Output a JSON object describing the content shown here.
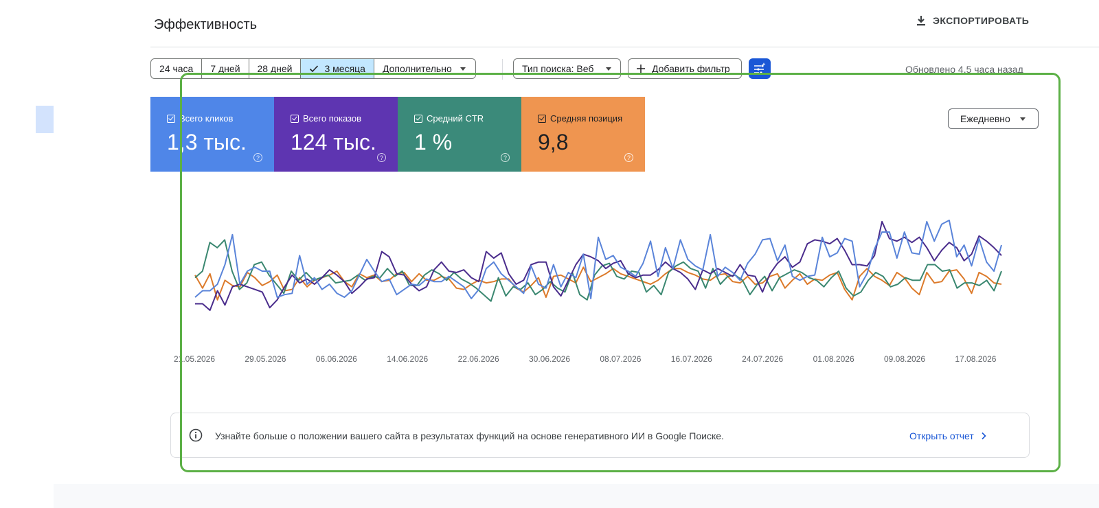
{
  "header": {
    "title": "Эффективность",
    "export_label": "ЭКСПОРТИРОВАТЬ"
  },
  "date_range": {
    "options": [
      "24 часа",
      "7 дней",
      "28 дней",
      "3 месяца",
      "Дополнительно"
    ],
    "selected": "3 месяца"
  },
  "filters": {
    "search_type": "Тип поиска: Веб",
    "add_filter": "Добавить фильтр",
    "updated": "Обновлено 4,5 часа назад"
  },
  "metrics": [
    {
      "label": "Всего кликов",
      "value": "1,3 тыс.",
      "color": "#4f86e8",
      "checked": true
    },
    {
      "label": "Всего показов",
      "value": "124 тыс.",
      "color": "#5e35b1",
      "checked": true
    },
    {
      "label": "Средний CTR",
      "value": "1 %",
      "color": "#3b8a7a",
      "checked": true
    },
    {
      "label": "Средняя позиция",
      "value": "9,8",
      "color": "#ef9550",
      "checked": true
    }
  ],
  "granularity": "Ежедневно",
  "chart_data": {
    "type": "line",
    "x_ticks": [
      "21.05.2026",
      "29.05.2026",
      "06.06.2026",
      "14.06.2026",
      "22.06.2026",
      "30.06.2026",
      "08.07.2026",
      "16.07.2026",
      "24.07.2026",
      "01.08.2026",
      "09.08.2026",
      "17.08.2026"
    ],
    "series": [
      {
        "name": "Всего кликов",
        "color": "#5a84d9",
        "values": [
          30,
          35,
          35,
          40,
          55,
          78,
          40,
          50,
          53,
          50,
          50,
          30,
          32,
          33,
          62,
          40,
          45,
          36,
          40,
          33,
          30,
          35,
          47,
          59,
          50,
          42,
          44,
          32,
          36,
          40,
          39,
          44,
          42,
          42,
          46,
          42,
          38,
          29,
          36,
          52,
          57,
          48,
          43,
          38,
          33,
          54,
          40,
          37,
          55,
          38,
          49,
          45,
          63,
          29,
          76,
          59,
          62,
          53,
          50,
          46,
          56,
          73,
          46,
          68,
          52,
          74,
          59,
          54,
          51,
          78,
          46,
          53,
          49,
          43,
          56,
          63,
          74,
          75,
          58,
          70,
          46,
          43,
          46,
          47,
          76,
          61,
          64,
          75,
          73,
          38,
          48,
          67,
          80,
          80,
          60,
          80,
          64,
          63,
          88,
          73,
          86,
          89,
          61,
          70,
          54,
          75,
          57,
          50,
          70
        ]
      },
      {
        "name": "Всего показов",
        "color": "#4a2c8c",
        "values": [
          25,
          25,
          20,
          35,
          24,
          38,
          40,
          38,
          36,
          34,
          22,
          28,
          38,
          47,
          41,
          44,
          40,
          45,
          51,
          47,
          42,
          33,
          38,
          44,
          45,
          65,
          61,
          48,
          47,
          40,
          35,
          38,
          51,
          57,
          50,
          49,
          51,
          45,
          42,
          65,
          60,
          64,
          48,
          40,
          43,
          55,
          57,
          57,
          38,
          31,
          43,
          55,
          63,
          61,
          58,
          52,
          56,
          58,
          48,
          45,
          47,
          47,
          51,
          57,
          52,
          49,
          44,
          36,
          51,
          48,
          52,
          49,
          46,
          55,
          47,
          46,
          34,
          48,
          56,
          61,
          53,
          57,
          71,
          74,
          73,
          71,
          75,
          66,
          55,
          55,
          54,
          62,
          88,
          75,
          73,
          76,
          72,
          76,
          68,
          58,
          66,
          72,
          68,
          58,
          63,
          77,
          73,
          68,
          62
        ]
      },
      {
        "name": "Средний CTR",
        "color": "#3a8770",
        "values": [
          45,
          50,
          72,
          68,
          74,
          50,
          36,
          41,
          55,
          57,
          47,
          40,
          33,
          50,
          43,
          49,
          43,
          45,
          47,
          41,
          42,
          43,
          47,
          43,
          46,
          45,
          52,
          46,
          50,
          39,
          39,
          47,
          51,
          48,
          43,
          49,
          44,
          41,
          37,
          32,
          27,
          45,
          31,
          38,
          36,
          41,
          32,
          36,
          42,
          37,
          34,
          49,
          32,
          28,
          47,
          54,
          56,
          46,
          44,
          50,
          49,
          34,
          39,
          32,
          49,
          54,
          57,
          52,
          50,
          37,
          52,
          40,
          46,
          47,
          43,
          32,
          40,
          46,
          35,
          45,
          48,
          51,
          49,
          45,
          43,
          38,
          45,
          50,
          37,
          31,
          34,
          43,
          49,
          46,
          38,
          40,
          45,
          43,
          43,
          55,
          55,
          50,
          51,
          37,
          41,
          41,
          39,
          43,
          35,
          50
        ]
      },
      {
        "name": "Средняя позиция",
        "color": "#dc7a2a",
        "values": [
          47,
          37,
          48,
          28,
          43,
          39,
          38,
          49,
          45,
          39,
          42,
          47,
          35,
          36,
          45,
          38,
          43,
          45,
          47,
          50,
          42,
          38,
          48,
          45,
          47,
          42,
          43,
          48,
          49,
          42,
          48,
          43,
          43,
          46,
          44,
          37,
          36,
          40,
          43,
          41,
          42,
          44,
          44,
          37,
          34,
          39,
          45,
          30,
          46,
          47,
          44,
          41,
          53,
          42,
          45,
          48,
          52,
          48,
          46,
          44,
          42,
          40,
          43,
          48,
          52,
          52,
          49,
          47,
          44,
          43,
          47,
          48,
          42,
          41,
          46,
          40,
          41,
          46,
          48,
          37,
          43,
          48,
          40,
          44,
          43,
          47,
          49,
          36,
          28,
          46,
          52,
          46,
          43,
          39,
          49,
          45,
          37,
          32,
          49,
          41,
          42,
          50,
          51,
          44,
          33,
          49,
          46,
          41,
          40
        ]
      }
    ]
  },
  "info_banner": {
    "text": "Узнайте больше о положении вашего сайта в результатах функций на основе генеративного ИИ в Google Поиске.",
    "link": "Открыть отчет"
  }
}
